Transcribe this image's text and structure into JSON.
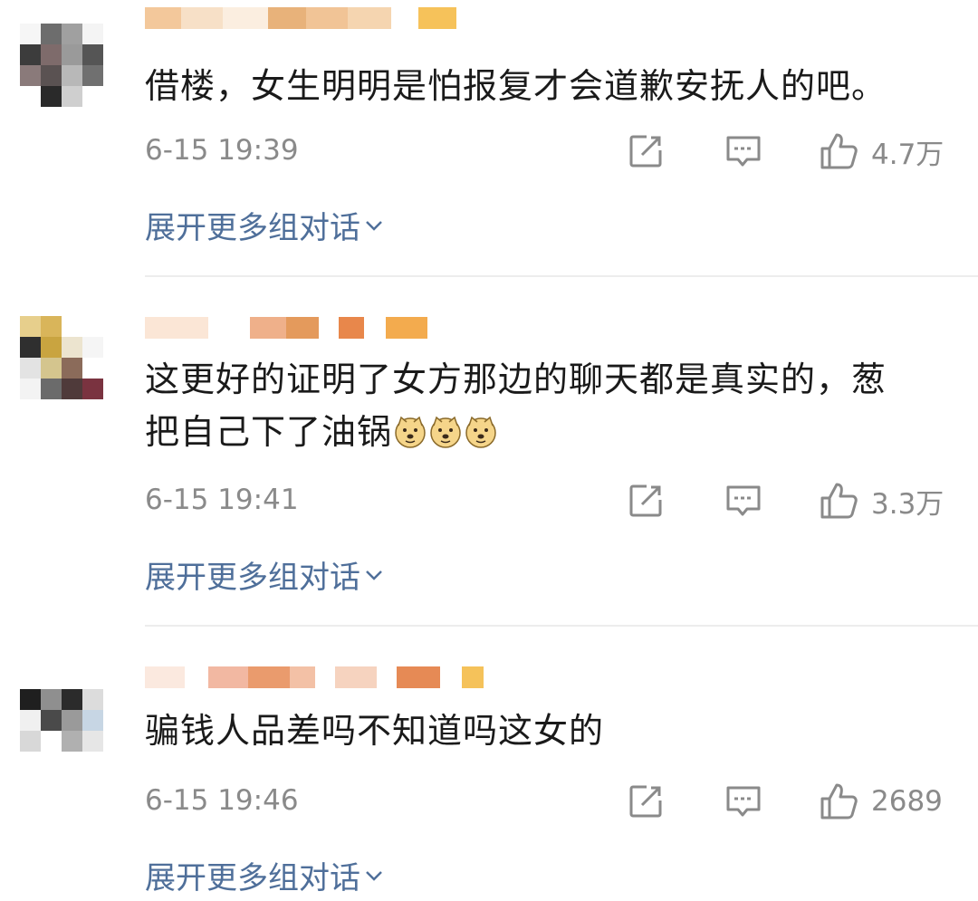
{
  "comments": [
    {
      "text": "借楼，女生明明是怕报复才会道歉安抚人的吧。",
      "time": "6-15 19:39",
      "likes": "4.7万",
      "expand": "展开更多组对话"
    },
    {
      "text_line1": "这更好的证明了女方那边的聊天都是真实的，葱",
      "text_line2": "把自己下了油锅",
      "time": "6-15 19:41",
      "likes": "3.3万",
      "expand": "展开更多组对话"
    },
    {
      "text": "骗钱人品差吗不知道吗这女的",
      "time": "6-15 19:46",
      "likes": "2689",
      "expand": "展开更多组对话"
    }
  ],
  "icons": {
    "share": "share-icon",
    "comment": "comment-icon",
    "like": "thumbs-up-icon",
    "expand": "chevron-down-icon",
    "emoji": "doge-emoji-icon"
  },
  "colors": {
    "text": "#1a1a1a",
    "meta": "#8a8a8a",
    "link": "#4f6f9a",
    "divider": "#ededed"
  }
}
